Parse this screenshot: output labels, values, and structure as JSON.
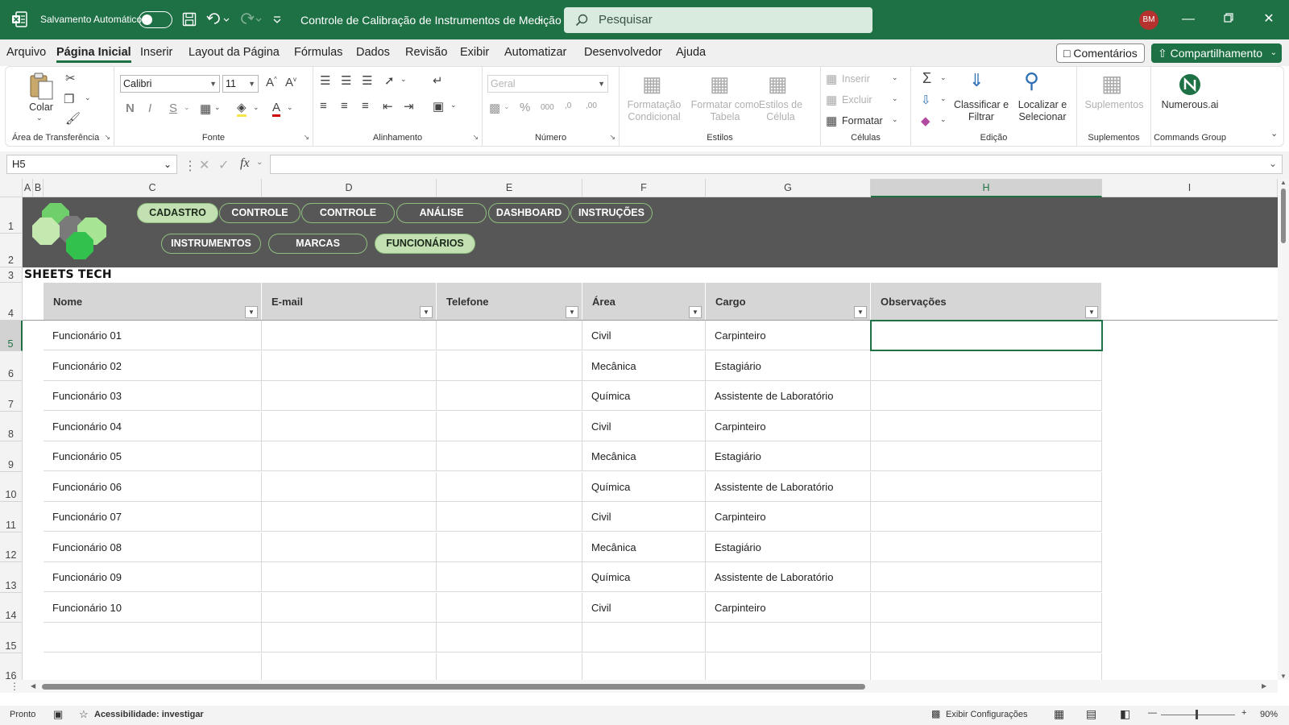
{
  "titlebar": {
    "autosave_label": "Salvamento Automático",
    "doc_title": "Controle de Calibração de Instrumentos de Medição",
    "search_placeholder": "Pesquisar",
    "avatar_initials": "BM"
  },
  "menu": {
    "tabs": [
      "Arquivo",
      "Página Inicial",
      "Inserir",
      "Layout da Página",
      "Fórmulas",
      "Dados",
      "Revisão",
      "Exibir",
      "Automatizar",
      "Desenvolvedor",
      "Ajuda"
    ],
    "active_tab": "Página Inicial",
    "comments_label": "Comentários",
    "share_label": "Compartilhamento"
  },
  "ribbon": {
    "clipboard": {
      "paste": "Colar",
      "group": "Área de Transferência"
    },
    "font": {
      "name": "Calibri",
      "size": "11",
      "group": "Fonte"
    },
    "alignment": {
      "group": "Alinhamento"
    },
    "number": {
      "format": "Geral",
      "group": "Número"
    },
    "styles": {
      "cond_format": "Formatação Condicional",
      "format_table": "Formatar como Tabela",
      "cell_styles": "Estilos de Célula",
      "group": "Estilos"
    },
    "cells": {
      "insert": "Inserir",
      "delete": "Excluir",
      "format": "Formatar",
      "group": "Células"
    },
    "editing": {
      "sort": "Classificar e Filtrar",
      "find": "Localizar e Selecionar",
      "group": "Edição"
    },
    "addins": {
      "label": "Suplementos",
      "group": "Suplementos"
    },
    "commands": {
      "label": "Numerous.ai",
      "group": "Commands Group"
    }
  },
  "formula_bar": {
    "name_box": "H5",
    "fx": "fx",
    "value": ""
  },
  "columns": [
    "A",
    "B",
    "C",
    "D",
    "E",
    "F",
    "G",
    "H",
    "I"
  ],
  "selected_column": "H",
  "rows": [
    "1",
    "2",
    "3",
    "4",
    "5",
    "6",
    "7",
    "8",
    "9",
    "10",
    "11",
    "12",
    "13",
    "14",
    "15",
    "16"
  ],
  "selected_row": "5",
  "nav": {
    "top": [
      "CADASTRO",
      "CONTROLE",
      "CONTROLE",
      "ANÁLISE",
      "DASHBOARD",
      "INSTRUÇÕES"
    ],
    "sub": [
      "INSTRUMENTOS",
      "MARCAS",
      "FUNCIONÁRIOS"
    ],
    "active_top": "CADASTRO",
    "active_sub": "FUNCIONÁRIOS"
  },
  "brand": "SHEETS TECH",
  "table": {
    "headers": [
      "Nome",
      "E-mail",
      "Telefone",
      "Área",
      "Cargo",
      "Observações"
    ],
    "rows": [
      [
        "Funcionário 01",
        "",
        "",
        "Civil",
        "Carpinteiro",
        ""
      ],
      [
        "Funcionário 02",
        "",
        "",
        "Mecânica",
        "Estagiário",
        ""
      ],
      [
        "Funcionário 03",
        "",
        "",
        "Química",
        "Assistente de Laboratório",
        ""
      ],
      [
        "Funcionário 04",
        "",
        "",
        "Civil",
        "Carpinteiro",
        ""
      ],
      [
        "Funcionário 05",
        "",
        "",
        "Mecânica",
        "Estagiário",
        ""
      ],
      [
        "Funcionário 06",
        "",
        "",
        "Química",
        "Assistente de Laboratório",
        ""
      ],
      [
        "Funcionário 07",
        "",
        "",
        "Civil",
        "Carpinteiro",
        ""
      ],
      [
        "Funcionário 08",
        "",
        "",
        "Mecânica",
        "Estagiário",
        ""
      ],
      [
        "Funcionário 09",
        "",
        "",
        "Química",
        "Assistente de Laboratório",
        ""
      ],
      [
        "Funcionário 10",
        "",
        "",
        "Civil",
        "Carpinteiro",
        ""
      ],
      [
        "",
        "",
        "",
        "",
        "",
        ""
      ],
      [
        "",
        "",
        "",
        "",
        "",
        ""
      ]
    ]
  },
  "status": {
    "ready": "Pronto",
    "accessibility": "Acessibilidade: investigar",
    "display_settings": "Exibir Configurações",
    "zoom": "90%"
  },
  "colors": {
    "excel_green": "#1e7145",
    "banner": "#575757",
    "nav_active": "#c3e0b3",
    "header_fill": "#d6d6d6"
  }
}
